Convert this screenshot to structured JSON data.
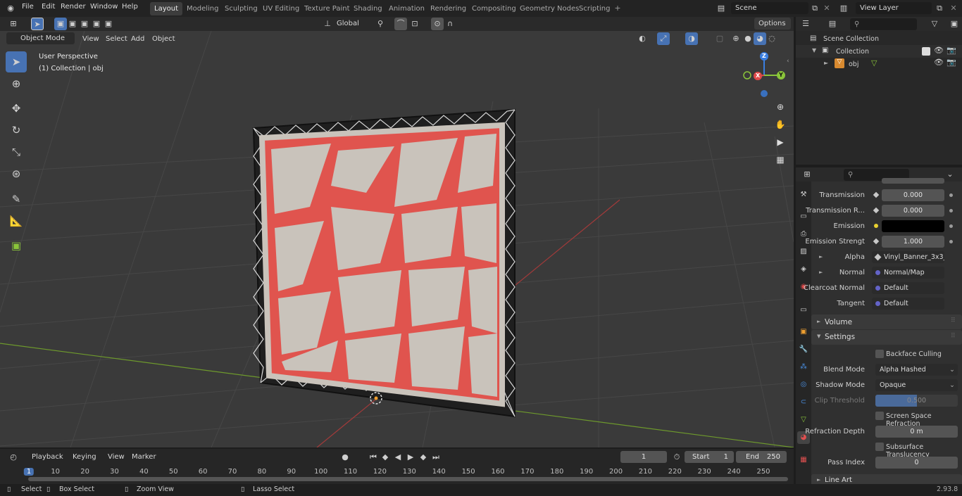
{
  "topbar": {
    "menus": [
      "File",
      "Edit",
      "Render",
      "Window",
      "Help"
    ],
    "workspaces": [
      "Layout",
      "Modeling",
      "Sculpting",
      "UV Editing",
      "Texture Paint",
      "Shading",
      "Animation",
      "Rendering",
      "Compositing",
      "Geometry Nodes",
      "Scripting"
    ],
    "active_workspace": "Layout",
    "scene_name": "Scene",
    "view_layer": "View Layer"
  },
  "tool_header": {
    "orientation": "Global",
    "options": "Options"
  },
  "viewport_header": {
    "mode": "Object Mode",
    "menus": [
      "View",
      "Select",
      "Add",
      "Object"
    ]
  },
  "viewport_overlay": {
    "view_name": "User Perspective",
    "collection_info": "(1) Collection | obj"
  },
  "gizmo": {
    "z": "Z",
    "y": "Y",
    "x": "X"
  },
  "outliner": {
    "scene_collection": "Scene Collection",
    "collection": "Collection",
    "object": "obj"
  },
  "properties": {
    "rows": [
      {
        "label": "Transmission",
        "value": "0.000"
      },
      {
        "label": "Transmission R...",
        "value": "0.000"
      },
      {
        "label": "Emission",
        "value": ""
      },
      {
        "label": "Emission Strengt",
        "value": "1.000"
      }
    ],
    "links": [
      {
        "label": "Alpha",
        "value": "Vinyl_Banner_3x3_...",
        "dot": "#c8c8c8",
        "expand": "►"
      },
      {
        "label": "Normal",
        "value": "Normal/Map",
        "dot": "#6363c7",
        "expand": "►"
      },
      {
        "label": "Clearcoat Normal",
        "value": "Default",
        "dot": "#6363c7",
        "expand": ""
      },
      {
        "label": "Tangent",
        "value": "Default",
        "dot": "#6363c7",
        "expand": ""
      }
    ],
    "sections": {
      "volume": "Volume",
      "settings": "Settings",
      "line_art": "Line Art"
    },
    "settings": {
      "backface_culling": "Backface Culling",
      "blend_mode_label": "Blend Mode",
      "blend_mode": "Alpha Hashed",
      "shadow_mode_label": "Shadow Mode",
      "shadow_mode": "Opaque",
      "clip_threshold_label": "Clip Threshold",
      "clip_threshold": "0.500",
      "ssr": "Screen Space Refraction",
      "refraction_depth_label": "Refraction Depth",
      "refraction_depth": "0 m",
      "subsurface": "Subsurface Translucency",
      "pass_index_label": "Pass Index",
      "pass_index": "0"
    }
  },
  "timeline": {
    "menus": [
      "Playback",
      "Keying",
      "View",
      "Marker"
    ],
    "current_frame": "1",
    "start_label": "Start",
    "start": "1",
    "end_label": "End",
    "end": "250",
    "ruler": [
      "1",
      "10",
      "20",
      "30",
      "40",
      "50",
      "60",
      "70",
      "80",
      "90",
      "100",
      "110",
      "120",
      "130",
      "140",
      "150",
      "160",
      "170",
      "180",
      "190",
      "200",
      "210",
      "220",
      "230",
      "240",
      "250"
    ]
  },
  "statusbar": {
    "select": "Select",
    "box_select": "Box Select",
    "zoom_view": "Zoom View",
    "lasso_select": "Lasso Select",
    "version": "2.93.8"
  },
  "colors": {
    "accent": "#4772b3",
    "x_axis": "#e04a4a",
    "y_axis": "#8ac53a",
    "z_axis": "#3a7ee0",
    "banner_red": "#e0544e",
    "banner_white": "#c9c3bb"
  }
}
